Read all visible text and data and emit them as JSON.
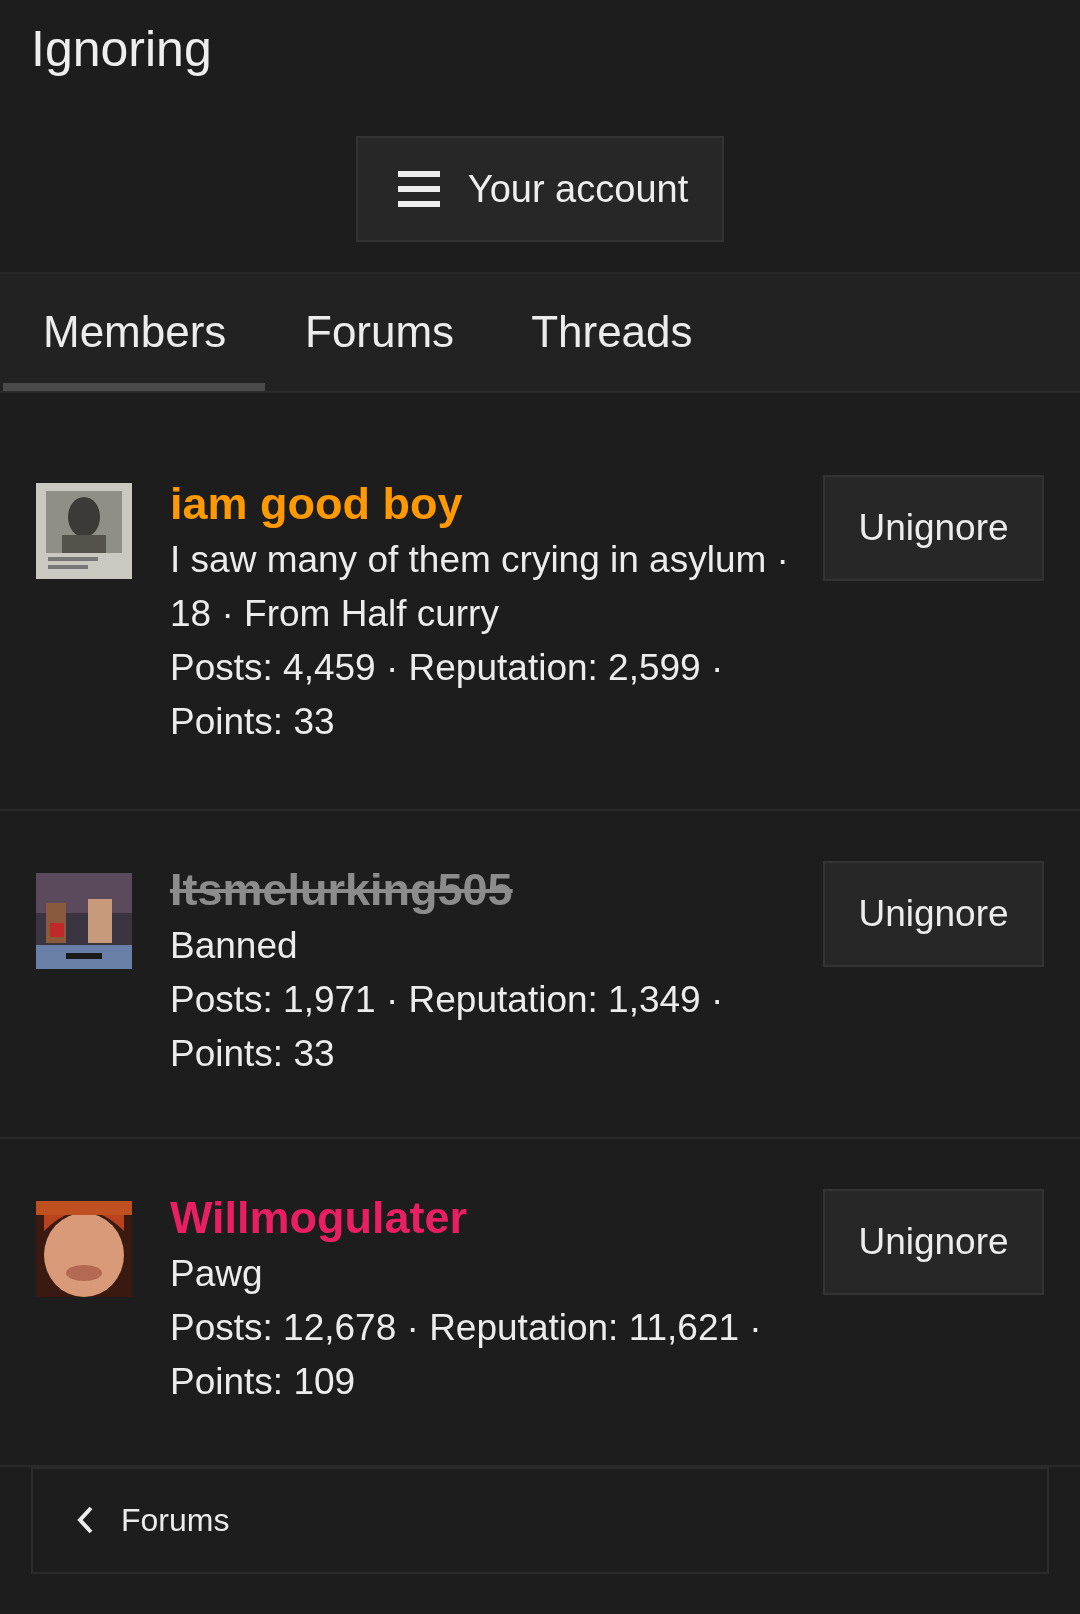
{
  "title": "Ignoring",
  "account_button": {
    "label": "Your account"
  },
  "tabs": [
    {
      "label": "Members",
      "selected": true
    },
    {
      "label": "Forums",
      "selected": false
    },
    {
      "label": "Threads",
      "selected": false
    }
  ],
  "members": [
    {
      "name": "iam good boy",
      "color": "#ff9900",
      "banned": false,
      "about": "I saw many of them crying in asylum · 18 · From Half curry",
      "stats": "Posts: 4,459 · Reputation: 2,599 · Points: 33",
      "button": "Unignore"
    },
    {
      "name": "Itsmelurking505",
      "color": "#8c8c8c",
      "banned": true,
      "about": "Banned",
      "stats": "Posts: 1,971 · Reputation: 1,349 · Points: 33",
      "button": "Unignore"
    },
    {
      "name": "Willmogulater",
      "color": "#ea1e63",
      "banned": false,
      "about": "Pawg",
      "stats": "Posts: 12,678 · Reputation: 11,621 · Points: 109",
      "button": "Unignore"
    }
  ],
  "breadcrumb": {
    "label": "Forums"
  }
}
